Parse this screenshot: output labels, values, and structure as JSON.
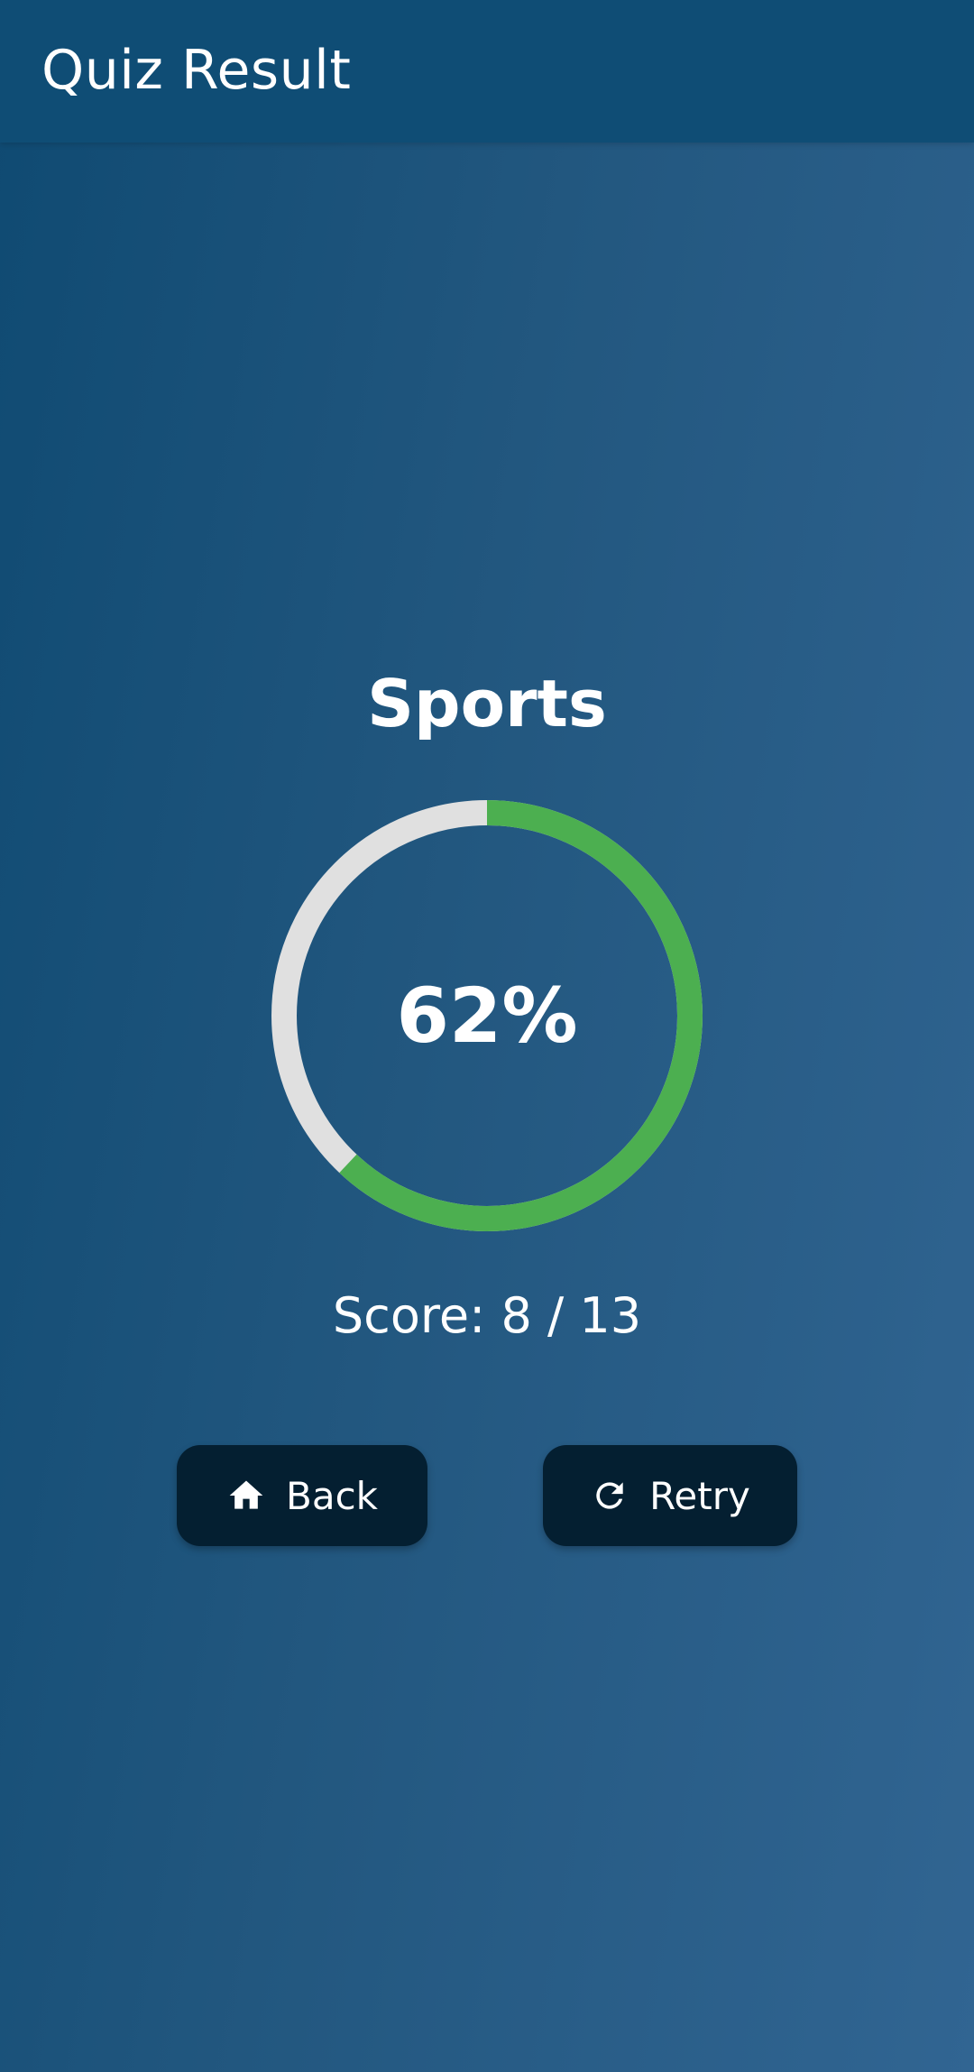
{
  "app_bar": {
    "title": "Quiz Result"
  },
  "result": {
    "category": "Sports",
    "percent": 0.62,
    "percent_label": "62%",
    "score_label": "Score: 8 / 13"
  },
  "actions": {
    "back": {
      "label": "Back",
      "icon": "home-icon"
    },
    "retry": {
      "label": "Retry",
      "icon": "refresh-icon"
    }
  },
  "colors": {
    "progress": "#4caf50",
    "track": "#e0e0e0",
    "button_bg": "#041f31",
    "app_bar": "#0f4d75"
  }
}
